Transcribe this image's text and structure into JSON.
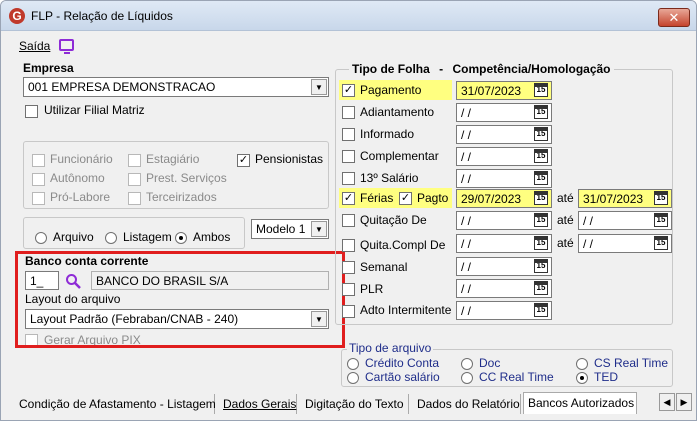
{
  "window": {
    "title": "FLP - Relação de Líquidos",
    "app_icon": "G",
    "close": "✕"
  },
  "menu": {
    "saida": "Saída"
  },
  "empresa": {
    "label": "Empresa",
    "value": "001 EMPRESA DEMONSTRACAO",
    "utilizar_filial": "Utilizar Filial Matriz"
  },
  "categorias": {
    "funcionario": "Funcionário",
    "estagiario": "Estagiário",
    "pensionistas": "Pensionistas",
    "autonomo": "Autônomo",
    "prest_servicos": "Prest. Serviços",
    "pro_labore": "Pró-Labore",
    "terceirizados": "Terceirizados"
  },
  "saida_opcoes": {
    "arquivo": "Arquivo",
    "listagem": "Listagem",
    "ambos": "Ambos",
    "modelo": "Modelo 1"
  },
  "banco": {
    "label": "Banco conta corrente",
    "code": "1_",
    "name": "BANCO DO BRASIL S/A",
    "layout_label": "Layout do arquivo",
    "layout_value": "Layout Padrão (Febraban/CNAB - 240)",
    "gerar_pix": "Gerar Arquivo PIX"
  },
  "folha": {
    "header_tipo": "Tipo de Folha",
    "header_sep": "-",
    "header_comp": "Competência/Homologação",
    "ate": "até",
    "rows": [
      {
        "label": "Pagamento",
        "date": "31/07/2023"
      },
      {
        "label": "Adiantamento",
        "date": "/ /"
      },
      {
        "label": "Informado",
        "date": "/ /"
      },
      {
        "label": "Complementar",
        "date": "/ /"
      },
      {
        "label": "13º Salário",
        "date": "/ /"
      },
      {
        "label": "Férias",
        "label2": "Pagto",
        "date": "29/07/2023",
        "date_ate": "31/07/2023"
      },
      {
        "label": "Quitação De",
        "date": "/ /",
        "date_ate": "/ /"
      },
      {
        "label": "Quita.Compl De",
        "date": "/ /",
        "date_ate": "/ /"
      },
      {
        "label": "Semanal",
        "date": "/ /"
      },
      {
        "label": "PLR",
        "date": "/ /"
      },
      {
        "label": "Adto Intermitente",
        "date": "/ /"
      }
    ],
    "cal_icon": "15"
  },
  "tipo_arquivo": {
    "label": "Tipo de arquivo",
    "credito_conta": "Crédito Conta",
    "cartao_salario": "Cartão salário",
    "doc": "Doc",
    "cc_real_time": "CC Real Time",
    "cs_real_time": "CS Real Time",
    "ted": "TED"
  },
  "tabs": [
    "Condição de Afastamento - Listagem",
    "Dados Gerais",
    "Digitação do Texto",
    "Dados do Relatório",
    "Bancos Autorizados"
  ],
  "nav": {
    "left": "◀",
    "right": "▶"
  },
  "colors": {
    "highlight": "#ffff80",
    "frame": "#e01e1e",
    "accent": "#8e2bd6"
  }
}
